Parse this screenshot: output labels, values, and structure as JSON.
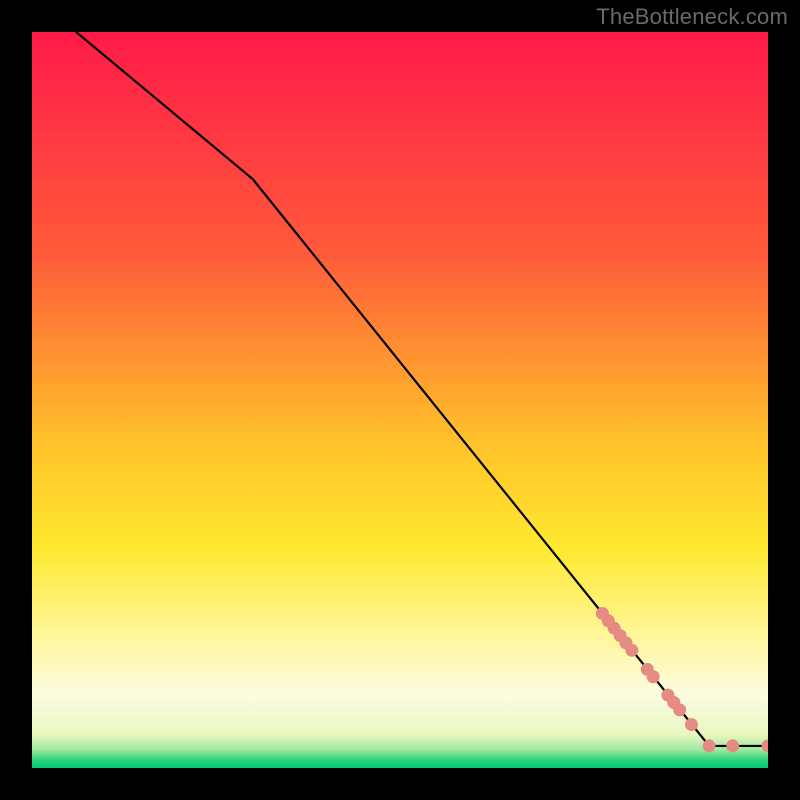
{
  "watermark": "TheBottleneck.com",
  "chart_data": {
    "type": "line",
    "title": "",
    "xlabel": "",
    "ylabel": "",
    "xlim": [
      0,
      100
    ],
    "ylim": [
      0,
      100
    ],
    "grid": false,
    "legend": false,
    "background_gradient": {
      "stops": [
        {
          "offset": 0.0,
          "color": "#ff1a49"
        },
        {
          "offset": 0.3,
          "color": "#ff5a3a"
        },
        {
          "offset": 0.55,
          "color": "#ffbf2a"
        },
        {
          "offset": 0.7,
          "color": "#ffe92e"
        },
        {
          "offset": 0.82,
          "color": "#fff69a"
        },
        {
          "offset": 0.9,
          "color": "#fcfce0"
        },
        {
          "offset": 0.955,
          "color": "#e8f7c0"
        },
        {
          "offset": 0.975,
          "color": "#9fe8a0"
        },
        {
          "offset": 0.99,
          "color": "#28d37a"
        },
        {
          "offset": 1.0,
          "color": "#00c878"
        }
      ]
    },
    "series": [
      {
        "name": "curve",
        "style": "line",
        "color": "#000000",
        "points_xy": [
          [
            6,
            100
          ],
          [
            30,
            80
          ],
          [
            92,
            3
          ],
          [
            100,
            3
          ]
        ]
      },
      {
        "name": "markers",
        "style": "scatter",
        "color": "#e58b82",
        "points_xy": [
          [
            77.5,
            21.0
          ],
          [
            78.3,
            20.0
          ],
          [
            79.1,
            19.0
          ],
          [
            79.9,
            18.0
          ],
          [
            80.7,
            17.0
          ],
          [
            81.5,
            16.0
          ],
          [
            83.6,
            13.4
          ],
          [
            84.4,
            12.4
          ],
          [
            86.4,
            9.9
          ],
          [
            87.2,
            8.9
          ],
          [
            88.0,
            7.9
          ],
          [
            89.6,
            5.9
          ],
          [
            92.0,
            3.0
          ],
          [
            95.2,
            3.0
          ],
          [
            100.0,
            3.0
          ]
        ]
      }
    ]
  }
}
